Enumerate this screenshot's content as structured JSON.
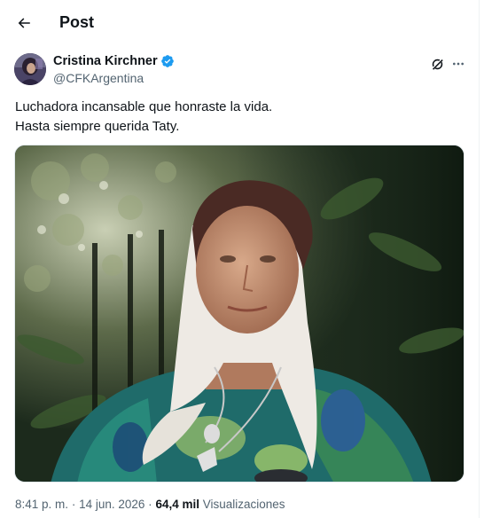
{
  "header": {
    "back_icon": "arrow-left-icon",
    "title": "Post"
  },
  "author": {
    "name": "Cristina Kirchner",
    "handle": "@CFKArgentina",
    "verified": true,
    "verified_color": "#1d9bf0"
  },
  "tweet": {
    "lines": [
      "Luchadora incansable que honraste la vida.",
      "Hasta siempre querida Taty."
    ]
  },
  "meta": {
    "time": "8:41 p. m.",
    "separator": "·",
    "date": "14 jun. 2026",
    "views_count": "64,4 mil",
    "views_label": "Visualizaciones"
  }
}
